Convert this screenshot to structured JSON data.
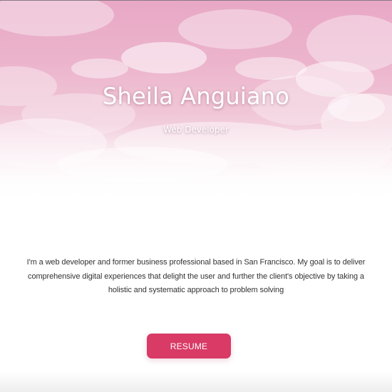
{
  "hero": {
    "name": "Sheila Anguiano",
    "role": "Web Developer",
    "background_colors": {
      "top": "#e8a8c6",
      "mid": "#f0c6d6",
      "cloud": "#f8e6ee"
    }
  },
  "about": {
    "bio": "I'm a web developer and former business professional based in San Francisco. My goal is to deliver comprehensive digital experiences that delight the user and further the client's objective by taking a holistic and systematic approach to problem solving"
  },
  "actions": {
    "resume_label": "RESUME",
    "accent_color": "#d93a66"
  }
}
